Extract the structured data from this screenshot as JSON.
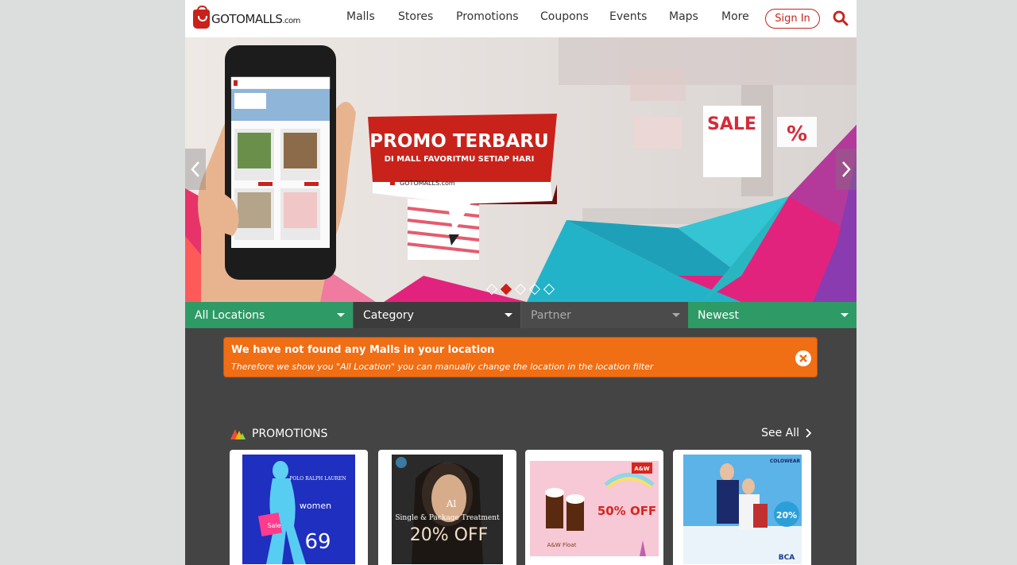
{
  "header": {
    "logo_text": "GOTOMALLS",
    "logo_suffix": ".com",
    "nav": [
      "Malls",
      "Stores",
      "Promotions",
      "Coupons",
      "Events",
      "Maps",
      "More"
    ],
    "signin_label": "Sign In"
  },
  "banner": {
    "headline": "PROMO TERBARU",
    "subline": "DI MALL FAVORITMU SETIAP HARI",
    "brand": "GOTOMALLS.com",
    "sale_sign": "SALE",
    "sale_sign2": "%",
    "dot_count": 5,
    "active_dot": 2
  },
  "filters": {
    "location": "All Locations",
    "category": "Category",
    "partner": "Partner",
    "sort": "Newest"
  },
  "alert": {
    "title": "We have not found any Malls in your location",
    "message": "Therefore we show you \"All Location\" you can manually change the location in the location filter"
  },
  "promotions": {
    "title": "PROMOTIONS",
    "see_all": "See All",
    "cards": [
      {
        "brand": "POLO RALPH LAUREN",
        "line1": "women",
        "line2": "Sale",
        "big": "69"
      },
      {
        "brand": "Al",
        "line1": "Single & Package Treatment",
        "big": "20% OFF"
      },
      {
        "brand": "A&W",
        "line1": "50% OFF",
        "line2": "A&W Float"
      },
      {
        "brand": "COLOWEAR",
        "line1": "20%",
        "line2": "BCA"
      }
    ]
  },
  "colors": {
    "brand_red": "#c9221b",
    "filter_green": "#2e9a65",
    "alert_orange": "#f06e14",
    "page_dark": "#444444"
  }
}
